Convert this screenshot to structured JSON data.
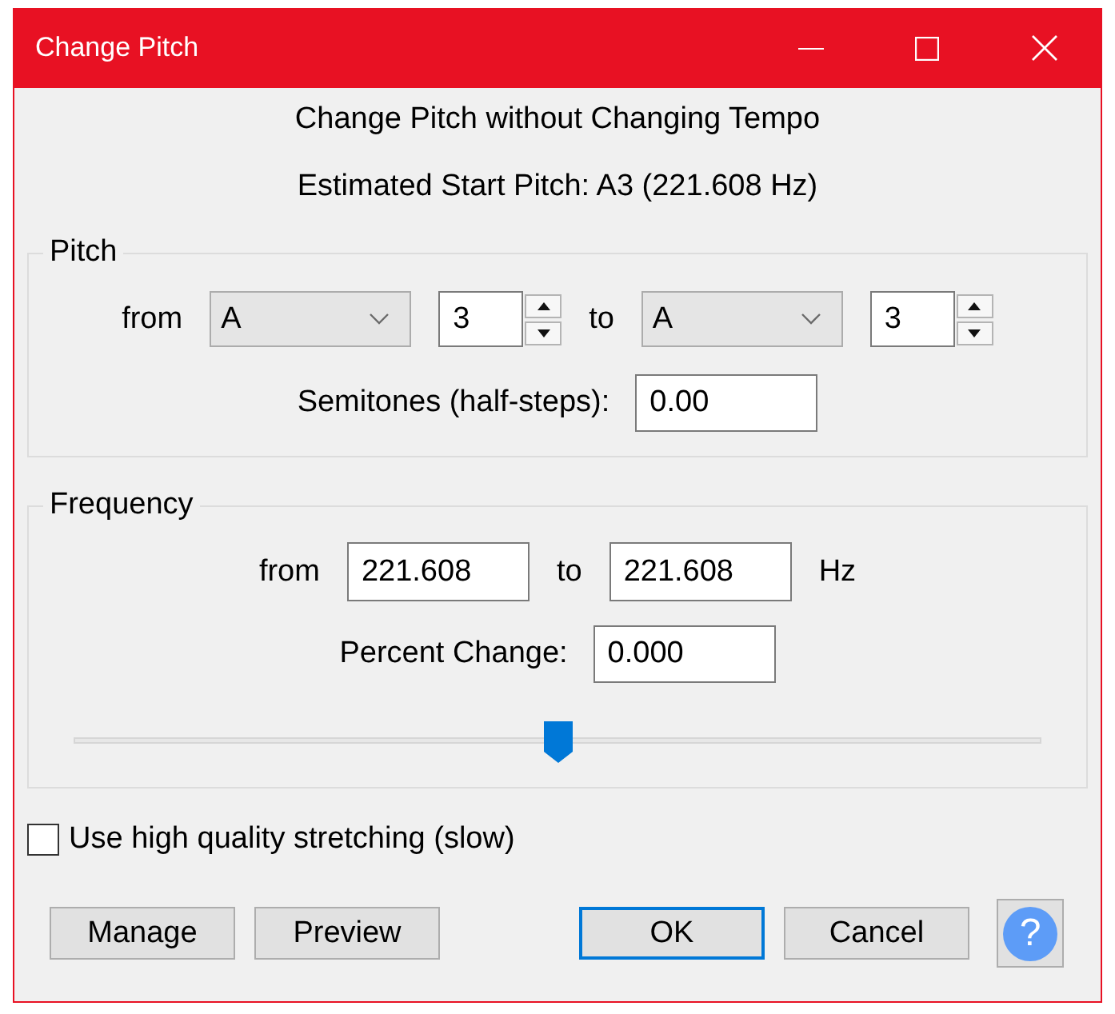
{
  "window": {
    "title": "Change Pitch"
  },
  "heading": "Change Pitch without Changing Tempo",
  "estimate": "Estimated Start Pitch: A3 (221.608 Hz)",
  "pitch_group": {
    "legend": "Pitch",
    "from_label": "from",
    "from_note": "A",
    "from_octave": "3",
    "to_label": "to",
    "to_note": "A",
    "to_octave": "3",
    "semitones_label": "Semitones (half-steps):",
    "semitones_value": "0.00"
  },
  "frequency_group": {
    "legend": "Frequency",
    "from_label": "from",
    "from_value": "221.608",
    "to_label": "to",
    "to_value": "221.608",
    "unit": "Hz",
    "percent_label": "Percent Change:",
    "percent_value": "0.000",
    "slider": {
      "level": 0.5
    }
  },
  "options": [
    {
      "label": "Use high quality stretching (slow)",
      "checked": false
    }
  ],
  "tool_buttons": [
    {
      "label": "Manage",
      "focused": false
    },
    {
      "label": "Preview",
      "focused": false
    }
  ],
  "dialog_buttons": [
    {
      "label": "OK",
      "focused": true
    },
    {
      "label": "Cancel",
      "focused": false
    }
  ],
  "help_button": {
    "label": "?"
  }
}
